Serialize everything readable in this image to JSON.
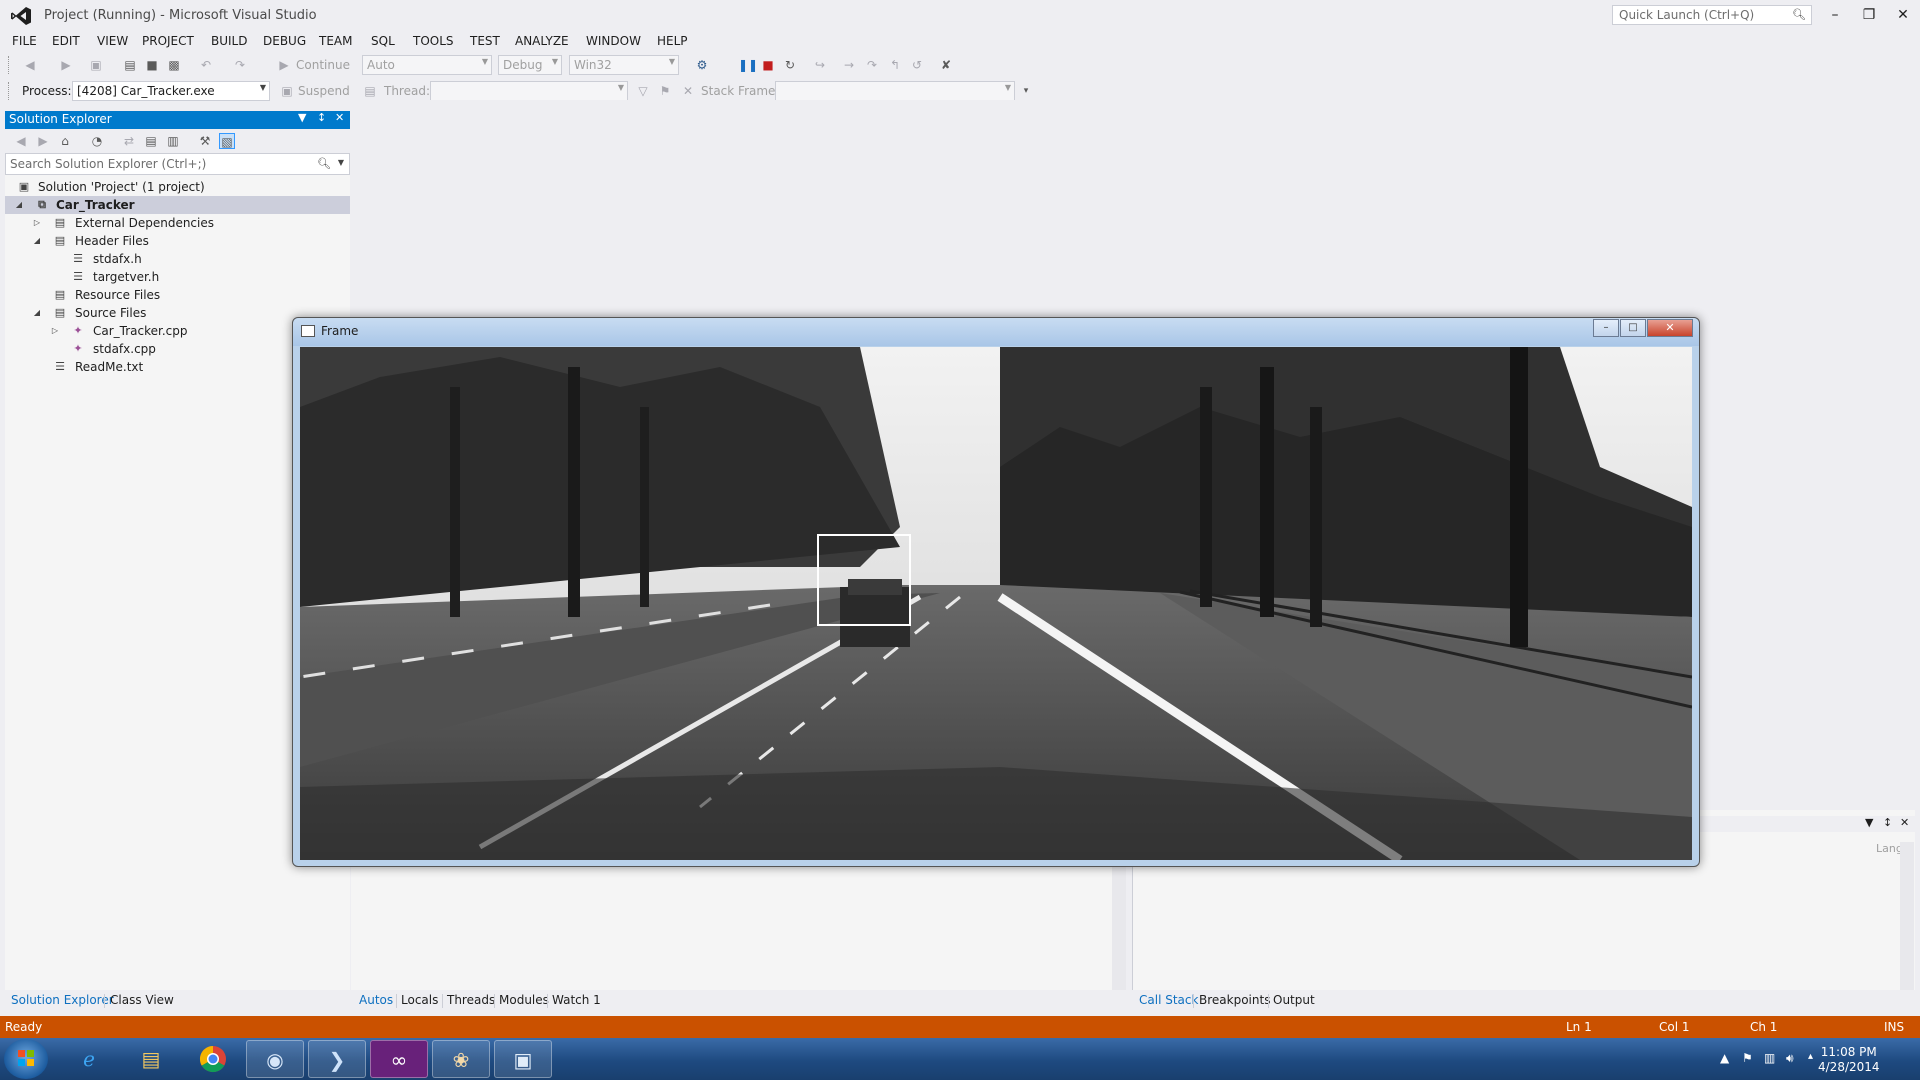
{
  "app": {
    "title": "Project (Running) - Microsoft Visual Studio",
    "quick_launch_placeholder": "Quick Launch (Ctrl+Q)"
  },
  "menu": [
    "FILE",
    "EDIT",
    "VIEW",
    "PROJECT",
    "BUILD",
    "DEBUG",
    "TEAM",
    "SQL",
    "TOOLS",
    "TEST",
    "ANALYZE",
    "WINDOW",
    "HELP"
  ],
  "toolbar": {
    "continue_label": "Continue",
    "auto_value": "Auto",
    "config_value": "Debug",
    "platform_value": "Win32",
    "process_label": "Process:",
    "process_value": "[4208] Car_Tracker.exe",
    "suspend_label": "Suspend",
    "thread_label": "Thread:",
    "stack_frame_label": "Stack Frame:"
  },
  "solution_explorer": {
    "title": "Solution Explorer",
    "search_placeholder": "Search Solution Explorer (Ctrl+;)",
    "tree": [
      {
        "label": "Solution 'Project' (1 project)",
        "icon": "solution-icon"
      },
      {
        "label": "Car_Tracker",
        "icon": "cpp-project-icon",
        "selected": true,
        "expanded": true
      },
      {
        "label": "External Dependencies",
        "icon": "folder-icon",
        "expanded": false
      },
      {
        "label": "Header Files",
        "icon": "folder-icon",
        "expanded": true
      },
      {
        "label": "stdafx.h",
        "icon": "header-file-icon"
      },
      {
        "label": "targetver.h",
        "icon": "header-file-icon"
      },
      {
        "label": "Resource Files",
        "icon": "folder-icon"
      },
      {
        "label": "Source Files",
        "icon": "folder-icon",
        "expanded": true
      },
      {
        "label": "Car_Tracker.cpp",
        "icon": "cpp-file-icon",
        "expanded": false
      },
      {
        "label": "stdafx.cpp",
        "icon": "cpp-file-icon"
      },
      {
        "label": "ReadMe.txt",
        "icon": "text-file-icon"
      }
    ],
    "tabs": [
      "Solution Explorer",
      "Class View"
    ]
  },
  "autos_tabs": [
    "Autos",
    "Locals",
    "Threads",
    "Modules",
    "Watch 1"
  ],
  "callstack_tabs": [
    "Call Stack",
    "Breakpoints",
    "Output"
  ],
  "callstack_column": "Lang",
  "status": {
    "text": "Ready",
    "line": "Ln 1",
    "col": "Col 1",
    "ch": "Ch 1",
    "mode": "INS"
  },
  "frame_window": {
    "title": "Frame"
  },
  "taskbar": {
    "apps": [
      "internet-explorer-icon",
      "file-explorer-icon",
      "chrome-icon",
      "app-icon",
      "powershell-icon",
      "visual-studio-icon",
      "paint-icon",
      "frame-app-icon"
    ],
    "time": "11:08 PM",
    "date": "4/28/2014"
  },
  "colors": {
    "accent": "#007acc",
    "status_bar": "#ca5100",
    "selection": "#cccedb"
  }
}
